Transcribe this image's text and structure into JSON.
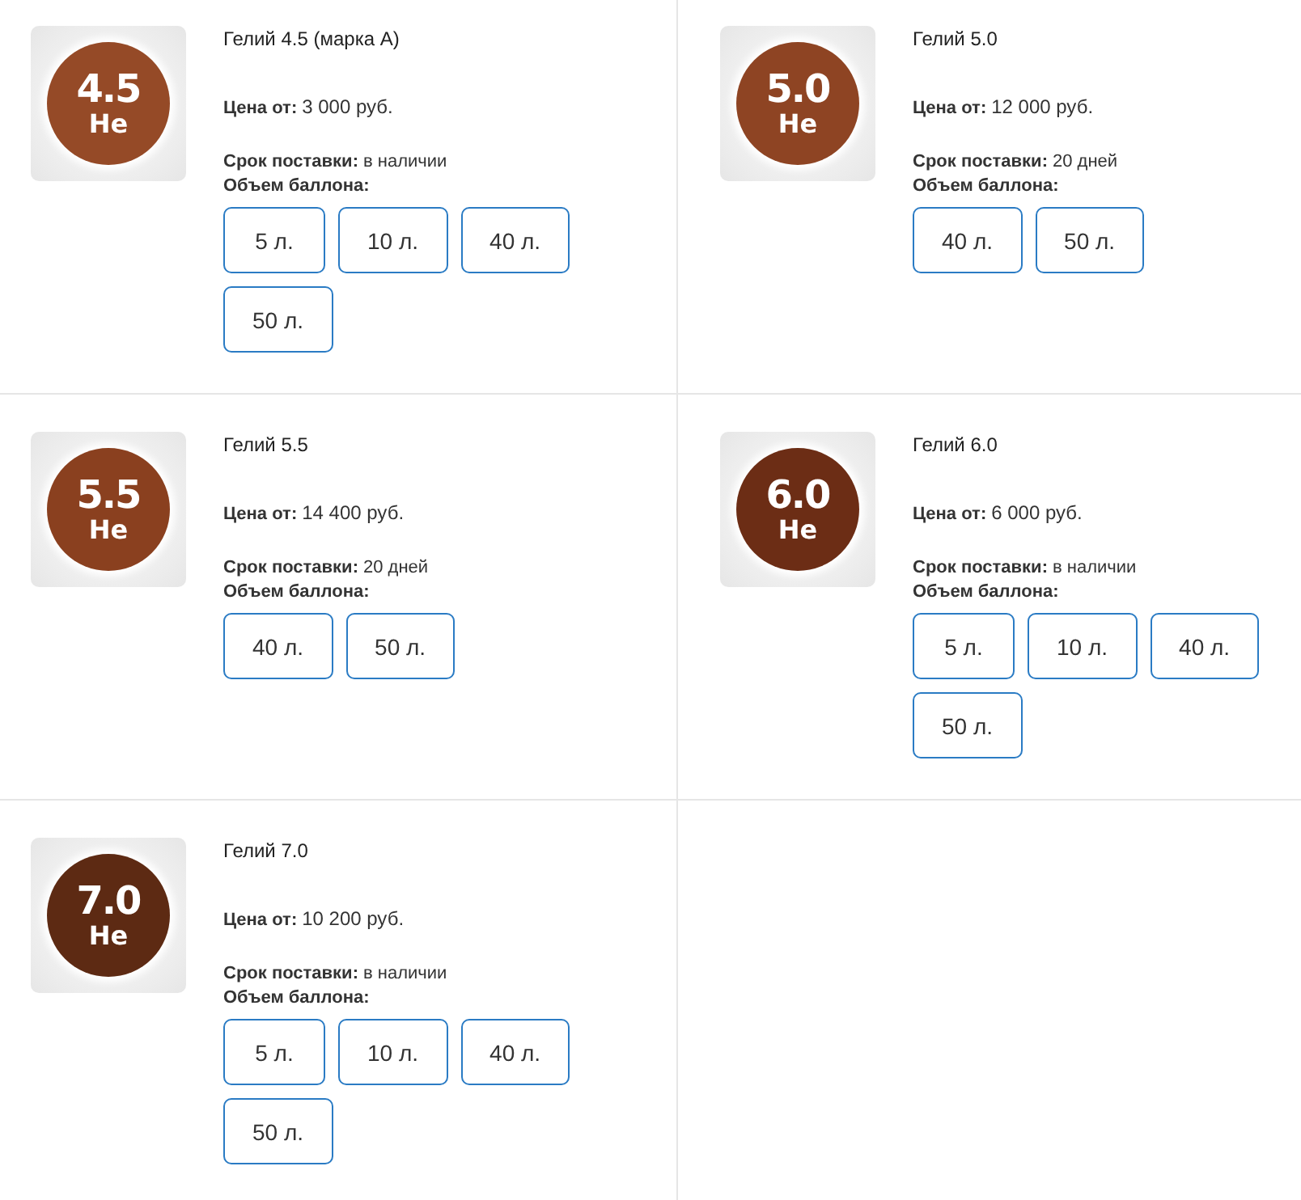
{
  "products": [
    {
      "badge": {
        "grade": "4.5",
        "symbol": "He",
        "color": "#954a27"
      },
      "name": "Гелий 4.5 (марка А)",
      "price_label": "Цена от:",
      "price": "3 000 руб.",
      "delivery_label": "Срок поставки:",
      "delivery": "в наличии",
      "volume_label": "Объем баллона:",
      "volumes": [
        "5 л.",
        "10 л.",
        "40 л.",
        "50 л."
      ]
    },
    {
      "badge": {
        "grade": "5.0",
        "symbol": "He",
        "color": "#8e4423"
      },
      "name": "Гелий 5.0",
      "price_label": "Цена от:",
      "price": "12 000 руб.",
      "delivery_label": "Срок поставки:",
      "delivery": "20 дней",
      "volume_label": "Объем баллона:",
      "volumes": [
        "40 л.",
        "50 л."
      ]
    },
    {
      "badge": {
        "grade": "5.5",
        "symbol": "He",
        "color": "#8a401f"
      },
      "name": "Гелий 5.5",
      "price_label": "Цена от:",
      "price": "14 400 руб.",
      "delivery_label": "Срок поставки:",
      "delivery": "20 дней",
      "volume_label": "Объем баллона:",
      "volumes": [
        "40 л.",
        "50 л."
      ]
    },
    {
      "badge": {
        "grade": "6.0",
        "symbol": "He",
        "color": "#6c2d15"
      },
      "name": "Гелий 6.0",
      "price_label": "Цена от:",
      "price": "6 000 руб.",
      "delivery_label": "Срок поставки:",
      "delivery": "в наличии",
      "volume_label": "Объем баллона:",
      "volumes": [
        "5 л.",
        "10 л.",
        "40 л.",
        "50 л."
      ]
    },
    {
      "badge": {
        "grade": "7.0",
        "symbol": "He",
        "color": "#5d2a13"
      },
      "name": "Гелий 7.0",
      "price_label": "Цена от:",
      "price": "10 200 руб.",
      "delivery_label": "Срок поставки:",
      "delivery": "в наличии",
      "volume_label": "Объем баллона:",
      "volumes": [
        "5 л.",
        "10 л.",
        "40 л.",
        "50 л."
      ]
    }
  ]
}
